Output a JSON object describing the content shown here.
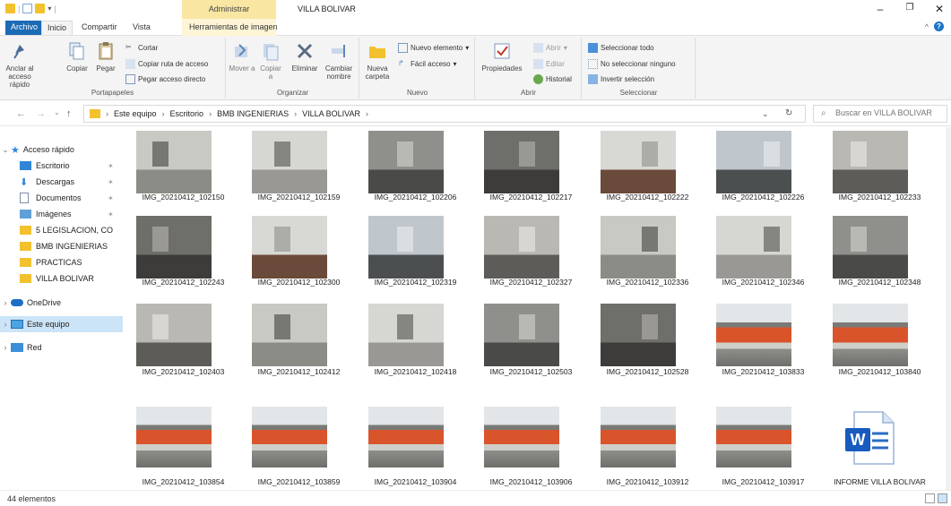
{
  "titlebar": {
    "contextual_tab": "Administrar",
    "window_title": "VILLA BOLIVAR"
  },
  "tabs": {
    "archivo": "Archivo",
    "inicio": "Inicio",
    "compartir": "Compartir",
    "vista": "Vista",
    "herramientas": "Herramientas de imagen"
  },
  "ribbon": {
    "portapapeles": {
      "label": "Portapapeles",
      "anclar": "Anclar al acceso rápido",
      "copiar": "Copiar",
      "pegar": "Pegar",
      "cortar": "Cortar",
      "copiar_ruta": "Copiar ruta de acceso",
      "pegar_acceso": "Pegar acceso directo"
    },
    "organizar": {
      "label": "Organizar",
      "mover": "Mover a",
      "copiar": "Copiar a",
      "eliminar": "Eliminar",
      "cambiar": "Cambiar nombre"
    },
    "nuevo": {
      "label": "Nuevo",
      "nueva_carpeta": "Nueva carpeta",
      "nuevo_elemento": "Nuevo elemento",
      "facil_acceso": "Fácil acceso"
    },
    "abrir": {
      "label": "Abrir",
      "propiedades": "Propiedades",
      "abrir": "Abrir",
      "editar": "Editar",
      "historial": "Historial"
    },
    "seleccionar": {
      "label": "Seleccionar",
      "todo": "Seleccionar todo",
      "ninguno": "No seleccionar ninguno",
      "invertir": "Invertir selección"
    }
  },
  "address": {
    "crumbs": [
      "Este equipo",
      "Escritorio",
      "BMB INGENIERIAS",
      "VILLA BOLIVAR"
    ],
    "search_placeholder": "Buscar en VILLA BOLIVAR"
  },
  "navpane": {
    "quick_access": "Acceso rápido",
    "pinned": [
      "Escritorio",
      "Descargas",
      "Documentos",
      "Imágenes"
    ],
    "folders": [
      "5 LEGISLACION, CO",
      "BMB INGENIERIAS",
      "PRACTICAS",
      "VILLA BOLIVAR"
    ],
    "onedrive": "OneDrive",
    "este_equipo": "Este equipo",
    "red": "Red"
  },
  "files": [
    [
      "IMG_20210412_102150",
      "IMG_20210412_102159",
      "IMG_20210412_102206",
      "IMG_20210412_102217",
      "IMG_20210412_102222",
      "IMG_20210412_102226",
      "IMG_20210412_102233"
    ],
    [
      "IMG_20210412_102243",
      "IMG_20210412_102300",
      "IMG_20210412_102319",
      "IMG_20210412_102327",
      "IMG_20210412_102336",
      "IMG_20210412_102346",
      "IMG_20210412_102348"
    ],
    [
      "IMG_20210412_102403",
      "IMG_20210412_102412",
      "IMG_20210412_102418",
      "IMG_20210412_102503",
      "IMG_20210412_102528",
      "IMG_20210412_103833",
      "IMG_20210412_103840"
    ],
    [
      "IMG_20210412_103854",
      "IMG_20210412_103859",
      "IMG_20210412_103904",
      "IMG_20210412_103906",
      "IMG_20210412_103912",
      "IMG_20210412_103917",
      "INFORME VILLA BOLIVAR"
    ]
  ],
  "status": {
    "count": "44 elementos"
  }
}
